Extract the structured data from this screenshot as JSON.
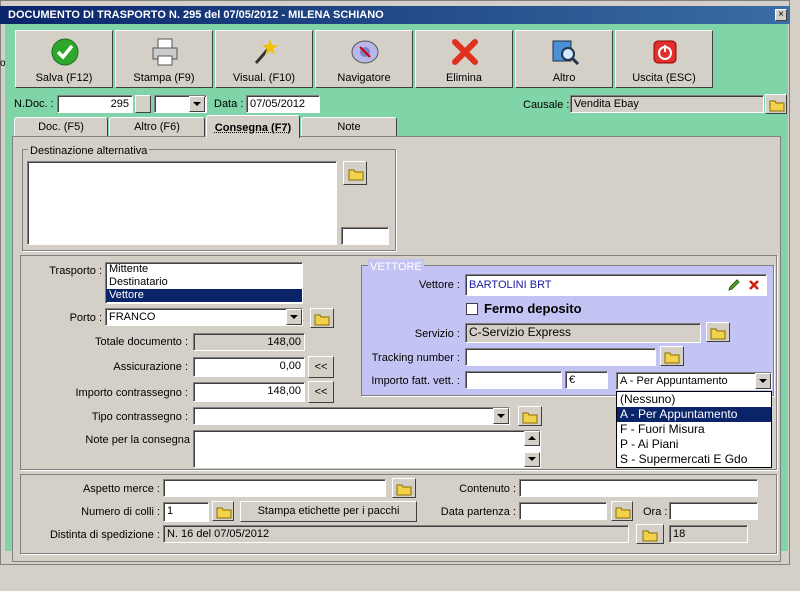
{
  "window": {
    "title": "DOCUMENTO DI TRASPORTO N. 295  del 07/05/2012 - MILENA SCHIANO",
    "close": "×"
  },
  "toolbar": {
    "salva": "Salva (F12)",
    "stampa": "Stampa (F9)",
    "visual": "Visual. (F10)",
    "navigatore": "Navigatore",
    "elimina": "Elimina",
    "altro": "Altro",
    "uscita": "Uscita (ESC)"
  },
  "header": {
    "ndoc_label": "N.Doc. :",
    "ndoc_value": "295",
    "data_label": "Data :",
    "data_value": "07/05/2012",
    "causale_label": "Causale :",
    "causale_value": "Vendita Ebay"
  },
  "tabs": {
    "doc": "Doc. (F5)",
    "altro": "Altro (F6)",
    "consegna": "Consegna (F7)",
    "note": "Note"
  },
  "destinazione": {
    "legend": "Destinazione alternativa",
    "value": "",
    "small": ""
  },
  "trasporto": {
    "label": "Trasporto :",
    "options": [
      "Mittente",
      "Destinatario",
      "Vettore"
    ],
    "selected": "Vettore"
  },
  "porto": {
    "label": "Porto :",
    "value": "FRANCO"
  },
  "totale": {
    "label": "Totale documento :",
    "value": "148,00"
  },
  "assicurazione": {
    "label": "Assicurazione :",
    "value": "0,00",
    "btn": "<<"
  },
  "contrassegno": {
    "label": "Importo contrassegno :",
    "value": "148,00",
    "btn": "<<"
  },
  "tipo_contrassegno": {
    "label": "Tipo contrassegno :",
    "value": ""
  },
  "note_consegna": {
    "label": "Note per la consegna",
    "value": ""
  },
  "vettore": {
    "legend": "VETTORE",
    "label": "Vettore :",
    "value": "BARTOLINI BRT",
    "fermo": "Fermo deposito",
    "servizio_label": "Servizio :",
    "servizio_value": "C-Servizio Express",
    "tracking_label": "Tracking number :",
    "tracking_value": "",
    "importo_label": "Importo fatt. vett. :",
    "importo_value": "",
    "currency": "€",
    "combo_value": "A - Per Appuntamento",
    "dropdown_options": [
      "(Nessuno)",
      "A - Per Appuntamento",
      "F - Fuori Misura",
      "P - Ai Piani",
      "S - Supermercati E Gdo"
    ],
    "dropdown_selected": "A - Per Appuntamento"
  },
  "bottom": {
    "aspetto_label": "Aspetto merce :",
    "aspetto_value": "",
    "contenuto_label": "Contenuto :",
    "contenuto_value": "",
    "colli_label": "Numero di colli :",
    "colli_value": "1",
    "stampa_etichette": "Stampa etichette per i pacchi",
    "data_partenza_label": "Data partenza :",
    "data_partenza_value": "",
    "ora_label": "Ora :",
    "ora_value": "",
    "distinta_label": "Distinta di spedizione :",
    "distinta_value": "N. 16 del 07/05/2012",
    "distinta_num": "18"
  },
  "left_edge_text": "o",
  "colors": {
    "green": "#7fd4a8",
    "vettore_bg": "#c4c4f4",
    "selection": "#0a246a"
  }
}
